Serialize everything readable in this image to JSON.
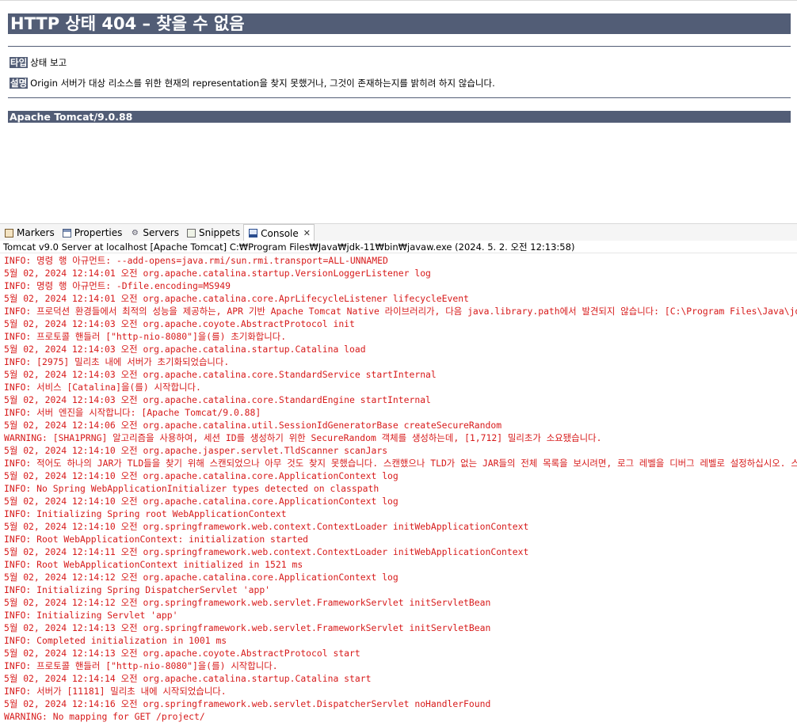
{
  "page": {
    "heading": "HTTP 상태 404 – 찾을 수 없음",
    "type_label": "타입",
    "type_value": "상태 보고",
    "desc_label": "설명",
    "desc_value": "Origin 서버가 대상 리소스를 위한 현재의 representation을 찾지 못했거나, 그것이 존재하는지를 밝히려 하지 않습니다.",
    "server_info": "Apache Tomcat/9.0.88"
  },
  "tabs": [
    {
      "label": "Markers",
      "icon": "markers-icon"
    },
    {
      "label": "Properties",
      "icon": "properties-icon"
    },
    {
      "label": "Servers",
      "icon": "servers-icon"
    },
    {
      "label": "Snippets",
      "icon": "snippets-icon"
    },
    {
      "label": "Console",
      "icon": "console-icon",
      "active": true,
      "close": "✕"
    }
  ],
  "status_line": "Tomcat v9.0 Server at localhost [Apache Tomcat] C:₩Program Files₩Java₩jdk-11₩bin₩javaw.exe  (2024. 5. 2. 오전 12:13:58)",
  "colors": {
    "header_bg": "#525d76",
    "console_text": "#d71a1a"
  },
  "console_lines": [
    "INFO: 명령 행 아규먼트:  --add-opens=java.rmi/sun.rmi.transport=ALL-UNNAMED",
    "5월 02, 2024 12:14:01 오전 org.apache.catalina.startup.VersionLoggerListener log",
    "INFO: 명령 행 아규먼트:  -Dfile.encoding=MS949",
    "5월 02, 2024 12:14:01 오전 org.apache.catalina.core.AprLifecycleListener lifecycleEvent",
    "INFO: 프로덕션 환경들에서 최적의 성능을 제공하는, APR 기반 Apache Tomcat Native 라이브러리가, 다음 java.library.path에서 발견되지 않습니다: [C:\\Program Files\\Java\\jdk",
    "5월 02, 2024 12:14:03 오전 org.apache.coyote.AbstractProtocol init",
    "INFO: 프로토콜 핸들러 [\"http-nio-8080\"]을(를) 초기화합니다.",
    "5월 02, 2024 12:14:03 오전 org.apache.catalina.startup.Catalina load",
    "INFO: [2975] 밀리초 내에 서버가 초기화되었습니다.",
    "5월 02, 2024 12:14:03 오전 org.apache.catalina.core.StandardService startInternal",
    "INFO: 서비스 [Catalina]을(를) 시작합니다.",
    "5월 02, 2024 12:14:03 오전 org.apache.catalina.core.StandardEngine startInternal",
    "INFO: 서버 엔진을 시작합니다: [Apache Tomcat/9.0.88]",
    "5월 02, 2024 12:14:06 오전 org.apache.catalina.util.SessionIdGeneratorBase createSecureRandom",
    "WARNING: [SHA1PRNG] 알고리즘을 사용하여, 세션 ID를 생성하기 위한 SecureRandom 객체를 생성하는데, [1,712] 밀리초가 소요됐습니다.",
    "5월 02, 2024 12:14:10 오전 org.apache.jasper.servlet.TldScanner scanJars",
    "INFO: 적어도 하나의 JAR가 TLD들을 찾기 위해 스캔되었으나 아무 것도 찾지 못했습니다. 스캔했으나 TLD가 없는 JAR들의 전체 목록을 보시려면, 로그 레벨을 디버그 레벨로 설정하십시오. 스캔 과정에",
    "5월 02, 2024 12:14:10 오전 org.apache.catalina.core.ApplicationContext log",
    "INFO: No Spring WebApplicationInitializer types detected on classpath",
    "5월 02, 2024 12:14:10 오전 org.apache.catalina.core.ApplicationContext log",
    "INFO: Initializing Spring root WebApplicationContext",
    "5월 02, 2024 12:14:10 오전 org.springframework.web.context.ContextLoader initWebApplicationContext",
    "INFO: Root WebApplicationContext: initialization started",
    "5월 02, 2024 12:14:11 오전 org.springframework.web.context.ContextLoader initWebApplicationContext",
    "INFO: Root WebApplicationContext initialized in 1521 ms",
    "5월 02, 2024 12:14:12 오전 org.apache.catalina.core.ApplicationContext log",
    "INFO: Initializing Spring DispatcherServlet 'app'",
    "5월 02, 2024 12:14:12 오전 org.springframework.web.servlet.FrameworkServlet initServletBean",
    "INFO: Initializing Servlet 'app'",
    "5월 02, 2024 12:14:13 오전 org.springframework.web.servlet.FrameworkServlet initServletBean",
    "INFO: Completed initialization in 1001 ms",
    "5월 02, 2024 12:14:13 오전 org.apache.coyote.AbstractProtocol start",
    "INFO: 프로토콜 핸들러 [\"http-nio-8080\"]을(를) 시작합니다.",
    "5월 02, 2024 12:14:14 오전 org.apache.catalina.startup.Catalina start",
    "INFO: 서버가 [11181] 밀리초 내에 시작되었습니다.",
    "5월 02, 2024 12:14:16 오전 org.springframework.web.servlet.DispatcherServlet noHandlerFound",
    "WARNING: No mapping for GET /project/"
  ]
}
